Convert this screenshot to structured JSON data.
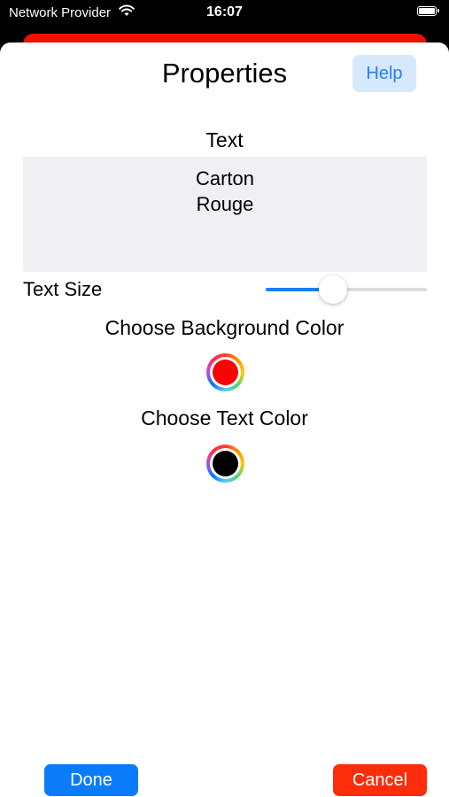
{
  "status_bar": {
    "carrier": "Network Provider",
    "time": "16:07"
  },
  "header": {
    "title": "Properties",
    "help_label": "Help"
  },
  "text_section": {
    "label": "Text",
    "value": "Carton\nRouge"
  },
  "text_size": {
    "label": "Text Size",
    "slider_value": 0.42
  },
  "background_color": {
    "label": "Choose Background Color",
    "color": "#ff0000"
  },
  "text_color": {
    "label": "Choose Text Color",
    "color": "#000000"
  },
  "footer": {
    "done_label": "Done",
    "cancel_label": "Cancel"
  },
  "colors": {
    "accent": "#0a7cfb",
    "cancel": "#fd2d0c",
    "behind_card": "#ee1100",
    "text_box_bg": "#efeff4"
  }
}
